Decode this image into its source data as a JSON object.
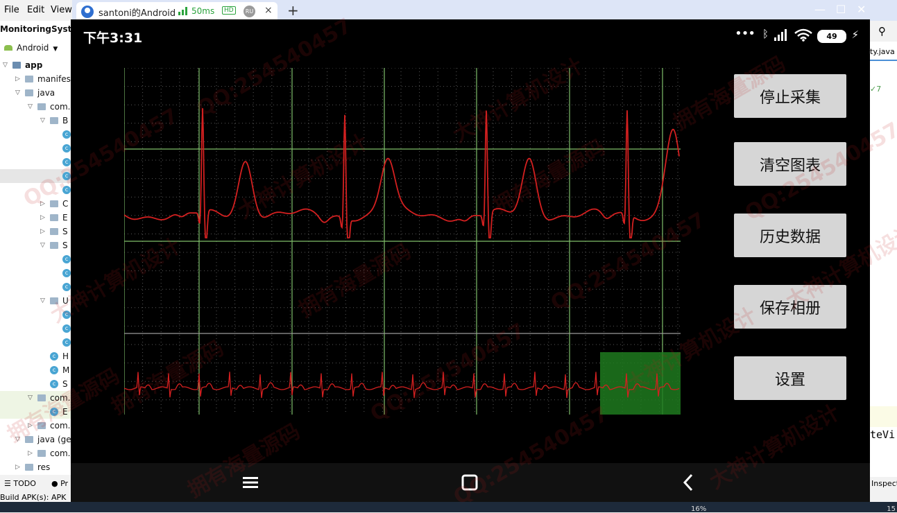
{
  "ide": {
    "menu": [
      "File",
      "Edit",
      "View"
    ],
    "project_title": "MonitoringSyste",
    "view_selector": "Android",
    "tree": [
      {
        "label": "app",
        "indent": 0,
        "type": "module",
        "arrow": "▽"
      },
      {
        "label": "manifes",
        "indent": 1,
        "type": "folder",
        "arrow": "▷"
      },
      {
        "label": "java",
        "indent": 1,
        "type": "folder",
        "arrow": "▽"
      },
      {
        "label": "com.",
        "indent": 2,
        "type": "folder",
        "arrow": "▽"
      },
      {
        "label": "B",
        "indent": 3,
        "type": "folder",
        "arrow": "▽"
      },
      {
        "label": "",
        "indent": 4,
        "type": "class"
      },
      {
        "label": "",
        "indent": 4,
        "type": "class"
      },
      {
        "label": "",
        "indent": 4,
        "type": "class"
      },
      {
        "label": "",
        "indent": 4,
        "type": "class",
        "selected": true
      },
      {
        "label": "",
        "indent": 4,
        "type": "class"
      },
      {
        "label": "C",
        "indent": 3,
        "type": "folder",
        "arrow": "▷"
      },
      {
        "label": "E",
        "indent": 3,
        "type": "folder",
        "arrow": "▷"
      },
      {
        "label": "S",
        "indent": 3,
        "type": "folder",
        "arrow": "▷"
      },
      {
        "label": "S",
        "indent": 3,
        "type": "folder",
        "arrow": "▽"
      },
      {
        "label": "",
        "indent": 4,
        "type": "class"
      },
      {
        "label": "",
        "indent": 4,
        "type": "class"
      },
      {
        "label": "",
        "indent": 4,
        "type": "class"
      },
      {
        "label": "U",
        "indent": 3,
        "type": "folder",
        "arrow": "▽"
      },
      {
        "label": "",
        "indent": 4,
        "type": "class"
      },
      {
        "label": "",
        "indent": 4,
        "type": "class"
      },
      {
        "label": "",
        "indent": 4,
        "type": "class"
      },
      {
        "label": "H",
        "indent": 3,
        "type": "class"
      },
      {
        "label": "M",
        "indent": 3,
        "type": "class"
      },
      {
        "label": "S",
        "indent": 3,
        "type": "class"
      },
      {
        "label": "com.",
        "indent": 2,
        "type": "folder",
        "arrow": "▽",
        "green": true
      },
      {
        "label": "E",
        "indent": 3,
        "type": "class",
        "green": true
      },
      {
        "label": "com.",
        "indent": 2,
        "type": "folder",
        "arrow": "▷"
      },
      {
        "label": "java (ge",
        "indent": 1,
        "type": "folder",
        "arrow": "▽"
      },
      {
        "label": "com.",
        "indent": 2,
        "type": "folder",
        "arrow": "▷"
      },
      {
        "label": "res",
        "indent": 1,
        "type": "folder",
        "arrow": "▷"
      }
    ],
    "bottom_tabs": [
      "TODO",
      "Pr"
    ],
    "build_status": "Build APK(s): APK",
    "right_text": [
      "ty.java",
      "7",
      "teVi",
      "Inspect"
    ]
  },
  "tab": {
    "title": "santoni的Android",
    "latency": "50ms",
    "hd": "HD",
    "badge": "RU",
    "close": "×",
    "new_tab": "+"
  },
  "window_controls": [
    "—",
    "☐",
    "✕"
  ],
  "phone": {
    "status_time": "下午3:31",
    "battery_level": "49",
    "buttons": [
      "停止采集",
      "清空图表",
      "历史数据",
      "保存相册",
      "设置"
    ]
  },
  "colors": {
    "ecg_trace": "#d42020",
    "grid_major": "#7fbf6a",
    "grid_minor": "#5a5a5a",
    "selection_window": "#1f7a1f",
    "button_bg": "#d6d6d6"
  },
  "ecg": {
    "main_signal": "ECG waveform, ~5.5 beats shown",
    "overview_signal": "compressed ECG strip with highlighted window"
  },
  "taskbar": {
    "left": "16%",
    "right": "15"
  },
  "watermarks": [
    "QQ:254540457",
    "大神计算机设计",
    "拥有海量源码"
  ]
}
